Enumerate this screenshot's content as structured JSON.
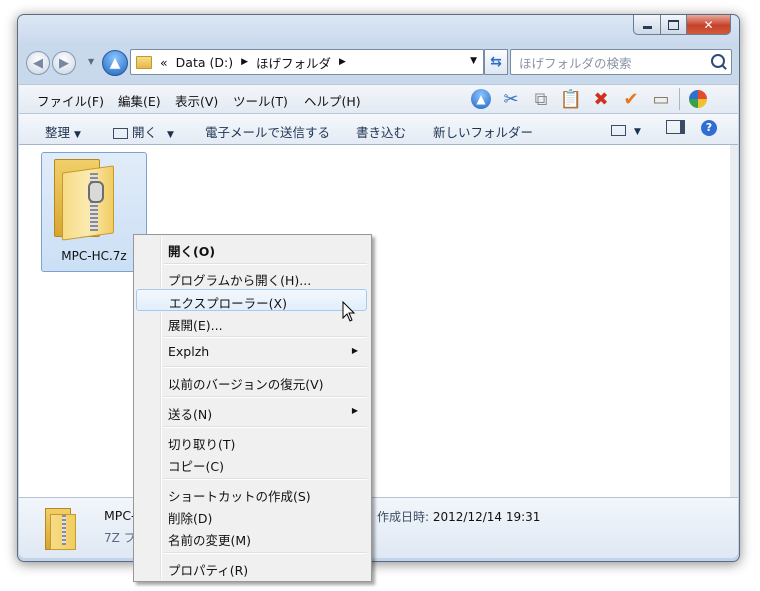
{
  "window": {
    "controls": {
      "minimize": "minimize",
      "maximize": "maximize",
      "close": "close"
    }
  },
  "nav": {
    "address_prefix": "«",
    "address_segments": [
      "Data (D:)",
      "ほげフォルダ"
    ],
    "search_placeholder": "ほげフォルダの検索"
  },
  "menubar": {
    "items": [
      "ファイル(F)",
      "編集(E)",
      "表示(V)",
      "ツール(T)",
      "ヘルプ(H)"
    ],
    "toolbar_icons": [
      "up-arrow-icon",
      "cut-icon",
      "copy-icon",
      "paste-icon",
      "delete-icon",
      "check-icon",
      "properties-icon",
      "views-icon"
    ]
  },
  "commandbar": {
    "organize": "整理",
    "open": "開く",
    "email": "電子メールで送信する",
    "burn": "書き込む",
    "new_folder": "新しいフォルダー"
  },
  "file": {
    "name": "MPC-HC.7z"
  },
  "details": {
    "name": "MPC-",
    "type": "7Z フ",
    "created_label": "作成日時:",
    "created_value": "2012/12/14 19:31"
  },
  "context_menu": {
    "open": "開く(O)",
    "open_with": "プログラムから開く(H)...",
    "explorer": "エクスプローラー(X)",
    "extract": "展開(E)...",
    "explzh": "Explzh",
    "restore": "以前のバージョンの復元(V)",
    "send_to": "送る(N)",
    "cut": "切り取り(T)",
    "copy": "コピー(C)",
    "shortcut": "ショートカットの作成(S)",
    "delete": "削除(D)",
    "rename": "名前の変更(M)",
    "properties": "プロパティ(R)"
  }
}
